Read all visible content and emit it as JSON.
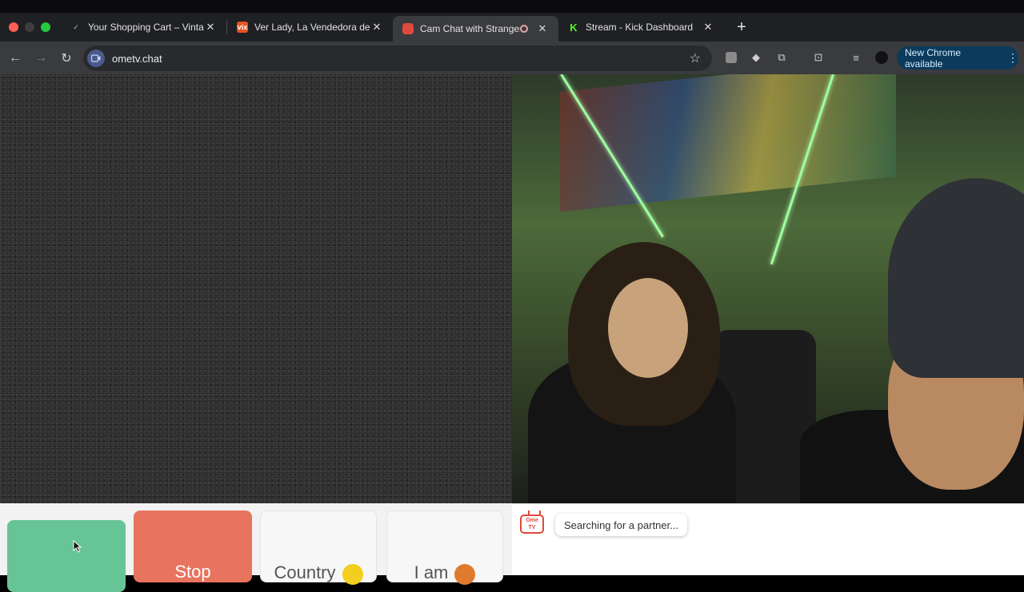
{
  "browser": {
    "tabs": [
      {
        "title": "Your Shopping Cart – Vintage",
        "icon": "check-icon",
        "active": false
      },
      {
        "title": "Ver Lady, La Vendedora de Ro",
        "icon": "vix-icon",
        "active": false
      },
      {
        "title": "Cam Chat with Strangers",
        "icon": "ometv-icon",
        "active": true
      },
      {
        "title": "Stream - Kick Dashboard",
        "icon": "kick-icon",
        "active": false
      }
    ],
    "url": "ometv.chat",
    "update_label": "New Chrome available"
  },
  "controls": {
    "start_label": "",
    "stop_label": "Stop",
    "country_label": "Country",
    "iam_label": "I am"
  },
  "chat": {
    "logo_text": "Ome TV",
    "status_message": "Searching for a partner..."
  },
  "colors": {
    "start": "#67c497",
    "stop": "#e8735e",
    "brand": "#e04a3c"
  }
}
